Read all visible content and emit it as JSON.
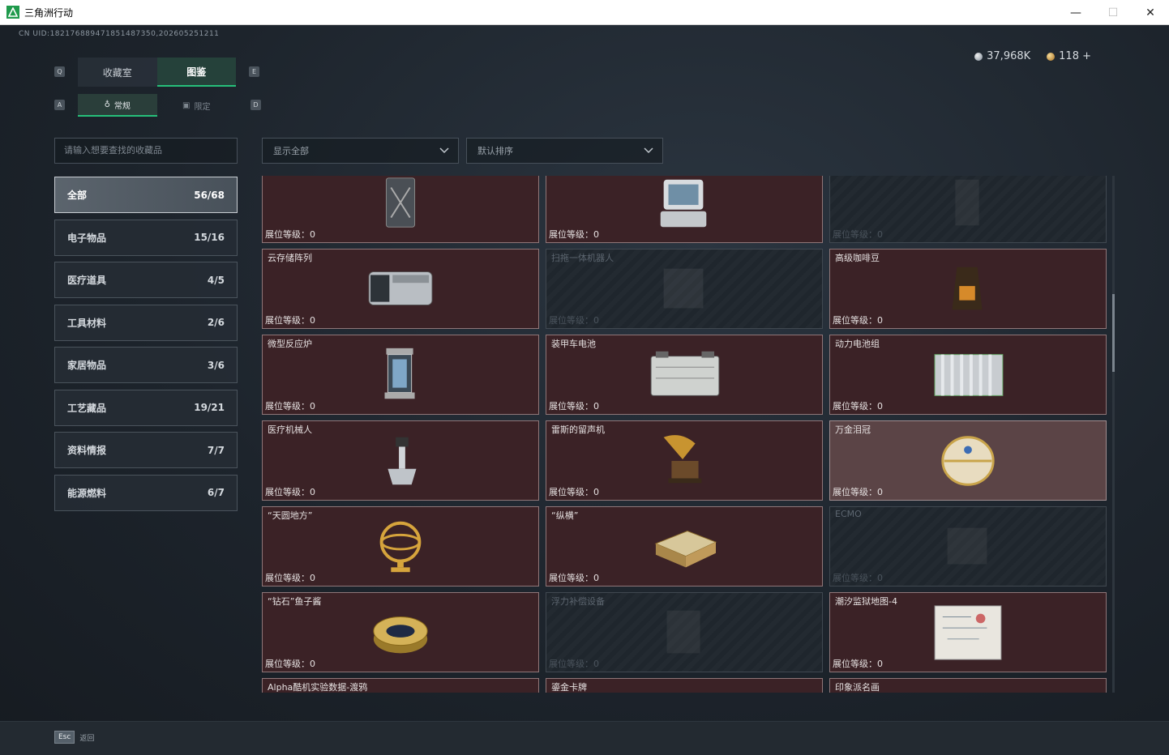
{
  "window": {
    "title": "三角洲行动",
    "buttons": {
      "minimize": "—",
      "maximize": "☐",
      "close": "✕"
    }
  },
  "uid": "CN UID:182176889471851487350,202605251211",
  "currency": {
    "silver": "37,968K",
    "gold": "118 +"
  },
  "key_hints": {
    "q": "Q",
    "e": "E",
    "a": "A",
    "d": "D"
  },
  "main_tabs": [
    {
      "label": "收藏室",
      "active": false
    },
    {
      "label": "图鉴",
      "active": true
    }
  ],
  "sub_tabs": [
    {
      "label": "常规",
      "active": true
    },
    {
      "label": "限定",
      "active": false
    }
  ],
  "search": {
    "placeholder": "请输入想要查找的收藏品"
  },
  "categories": [
    {
      "label": "全部",
      "count": "56/68",
      "active": true
    },
    {
      "label": "电子物品",
      "count": "15/16"
    },
    {
      "label": "医疗道具",
      "count": "4/5"
    },
    {
      "label": "工具材料",
      "count": "2/6"
    },
    {
      "label": "家居物品",
      "count": "3/6"
    },
    {
      "label": "工艺藏品",
      "count": "19/21"
    },
    {
      "label": "资料情报",
      "count": "7/7"
    },
    {
      "label": "能源燃料",
      "count": "6/7"
    }
  ],
  "filters": {
    "show": "显示全部",
    "sort": "默认排序"
  },
  "level_label": "展位等级：0",
  "cards": [
    {
      "name": "",
      "locked": false,
      "icon": "jerrycan-icon"
    },
    {
      "name": "",
      "locked": false,
      "icon": "terminal-icon"
    },
    {
      "name": "",
      "locked": true,
      "icon": "unknown-icon"
    },
    {
      "name": "云存储阵列",
      "locked": false,
      "icon": "storage-array-icon"
    },
    {
      "name": "扫拖一体机器人",
      "locked": true,
      "icon": "robot-vacuum-icon"
    },
    {
      "name": "高级咖啡豆",
      "locked": false,
      "icon": "coffee-bag-icon"
    },
    {
      "name": "微型反应炉",
      "locked": false,
      "icon": "reactor-icon"
    },
    {
      "name": "装甲车电池",
      "locked": false,
      "icon": "battery-icon"
    },
    {
      "name": "动力电池组",
      "locked": false,
      "icon": "battery-pack-icon"
    },
    {
      "name": "医疗机械人",
      "locked": false,
      "icon": "medical-robot-icon"
    },
    {
      "name": "雷斯的留声机",
      "locked": false,
      "icon": "gramophone-icon"
    },
    {
      "name": "万金泪冠",
      "locked": false,
      "highlight": true,
      "icon": "jeweled-egg-icon"
    },
    {
      "name": "“天圆地方”",
      "locked": false,
      "icon": "armillary-icon"
    },
    {
      "name": "“纵横”",
      "locked": false,
      "icon": "chess-box-icon"
    },
    {
      "name": "ECMO",
      "locked": true,
      "icon": "ecmo-icon"
    },
    {
      "name": "“钻石”鱼子酱",
      "locked": false,
      "icon": "caviar-tin-icon"
    },
    {
      "name": "浮力补偿设备",
      "locked": true,
      "icon": "bcd-icon"
    },
    {
      "name": "潮汐监狱地图-4",
      "locked": false,
      "icon": "map-icon"
    },
    {
      "name": "Alpha酷机实验数据-渡鸦",
      "locked": false,
      "icon": "data-icon"
    },
    {
      "name": "鎏金卡牌",
      "locked": false,
      "icon": "card-icon"
    },
    {
      "name": "印象派名画",
      "locked": false,
      "icon": "painting-icon"
    }
  ],
  "footer": {
    "esc_key": "Esc",
    "esc_label": "返回"
  },
  "colors": {
    "accent": "#26c07a",
    "card_bg": "#3b2226",
    "card_border": "#8f7678"
  }
}
